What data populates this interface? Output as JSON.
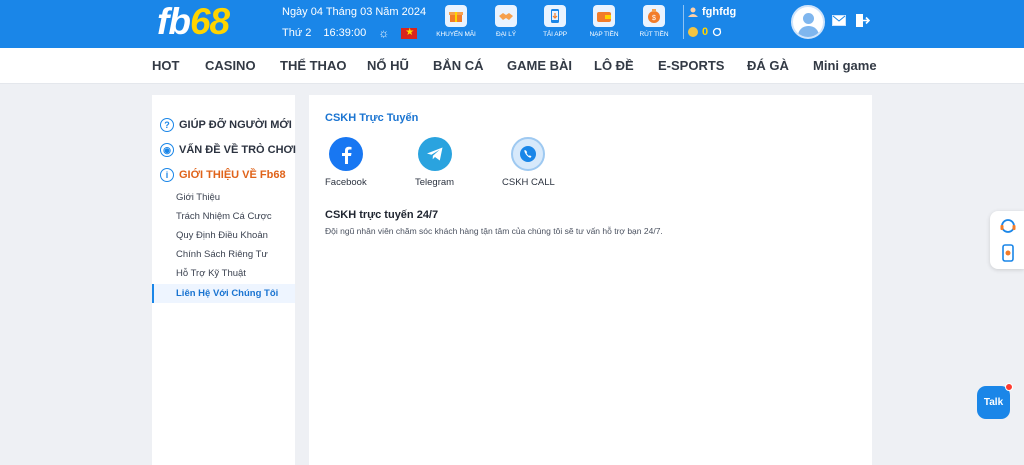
{
  "header": {
    "logo_fb": "fb",
    "logo_68": "68",
    "date": "Ngày 04 Tháng 03 Năm 2024",
    "weekday": "Thứ 2",
    "time": "16:39:00",
    "quick_links": [
      {
        "label": "KHUYẾN MÃI",
        "icon": "gift-icon"
      },
      {
        "label": "ĐẠI LÝ",
        "icon": "handshake-icon"
      },
      {
        "label": "TẢI APP",
        "icon": "phone-download-icon"
      },
      {
        "label": "NẠP TIỀN",
        "icon": "wallet-icon"
      },
      {
        "label": "RÚT TIỀN",
        "icon": "money-bag-icon"
      }
    ],
    "username": "fghfdg",
    "balance": "0"
  },
  "nav": {
    "items": [
      "HOT",
      "CASINO",
      "THỂ THAO",
      "NỔ HŨ",
      "BẮN CÁ",
      "GAME BÀI",
      "LÔ ĐỀ",
      "E-SPORTS",
      "ĐÁ GÀ",
      "Mini game"
    ]
  },
  "sidebar": {
    "categories": [
      {
        "label": "GIÚP ĐỠ NGƯỜI MỚI",
        "icon": "?"
      },
      {
        "label": "VẤN ĐỀ VỀ TRÒ CHƠI",
        "icon": "◉"
      },
      {
        "label": "GIỚI THIỆU VỀ Fb68",
        "icon": "i"
      }
    ],
    "sub_items": [
      "Giới Thiệu",
      "Trách Nhiệm Cá Cược",
      "Quy Định Điều Khoản",
      "Chính Sách Riêng Tư",
      "Hỗ Trợ Kỹ Thuật",
      "Liên Hệ Với Chúng Tôi"
    ]
  },
  "main": {
    "title": "CSKH Trực Tuyến",
    "contacts": [
      {
        "label": "Facebook",
        "icon": "facebook-icon"
      },
      {
        "label": "Telegram",
        "icon": "telegram-icon"
      },
      {
        "label": "CSKH CALL",
        "icon": "phone-call-icon"
      }
    ],
    "support_heading": "CSKH trực tuyến 24/7",
    "support_text": "Đội ngũ nhân viên chăm sóc khách hàng tận tâm của chúng tôi sẽ tư vấn hỗ trợ bạn 24/7."
  },
  "float": {
    "talk_label": "Talk"
  },
  "colors": {
    "brand_blue": "#1a86e8",
    "logo_yellow": "#ffd400",
    "active_orange": "#e0631a"
  }
}
